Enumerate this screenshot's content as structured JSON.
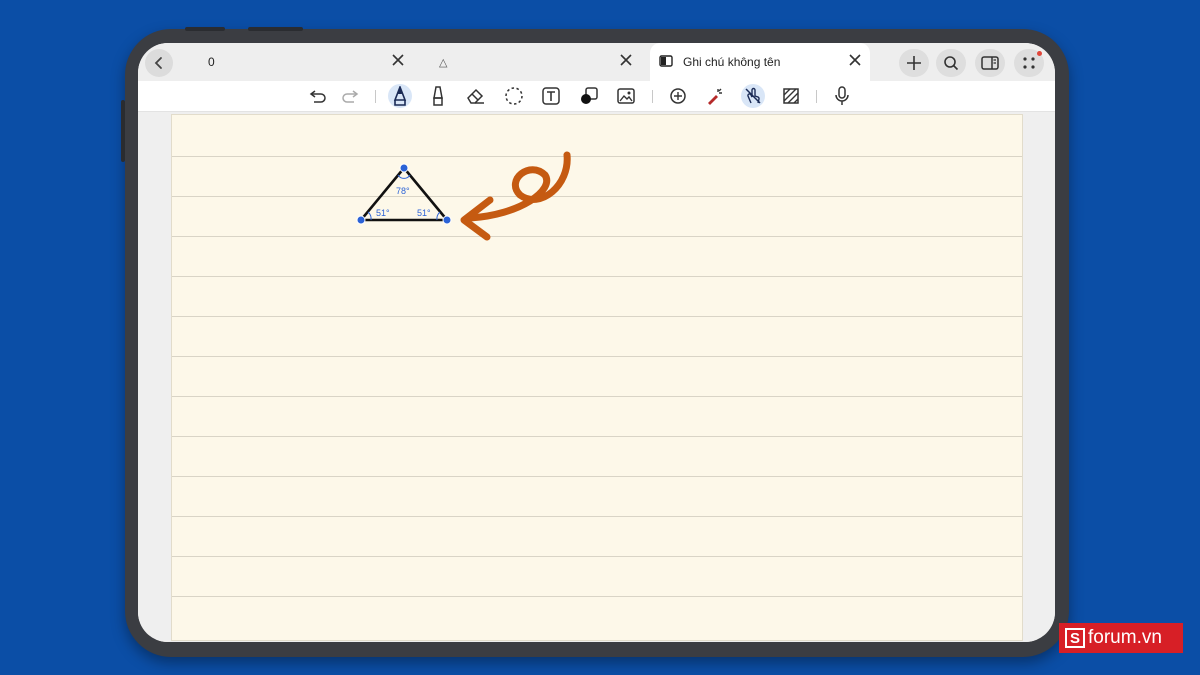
{
  "tabs": [
    {
      "label": "0",
      "active": false
    },
    {
      "label": "△",
      "active": false
    },
    {
      "label": "Ghi chú không tên",
      "active": true
    }
  ],
  "tab_actions": [
    "plus-icon",
    "search-icon",
    "split-view-icon",
    "more-dots-icon"
  ],
  "toolbar": {
    "tools": [
      "undo-icon",
      "redo-icon",
      "pen-icon",
      "highlighter-icon",
      "eraser-icon",
      "lasso-select-icon",
      "text-box-icon",
      "shape-icon",
      "image-icon",
      "zoom-icon",
      "laser-pointer-icon",
      "touch-draw-icon",
      "pattern-icon",
      "microphone-icon"
    ],
    "selected": [
      "pen-icon",
      "touch-draw-icon"
    ]
  },
  "drawing": {
    "angles": {
      "top": "78°",
      "left": "51°",
      "right": "51°"
    }
  },
  "colors": {
    "background": "#0b4ea6",
    "paper": "#fdf8e9",
    "arrow": "#c55a11",
    "handle": "#2b62d6"
  },
  "logo": {
    "mark": "S",
    "text": "forum.vn"
  }
}
